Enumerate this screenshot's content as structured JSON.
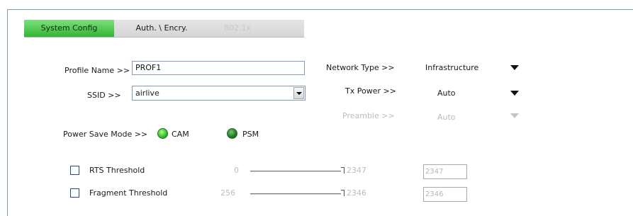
{
  "tabs": {
    "system_config": "System Config",
    "auth_encry": "Auth. \\ Encry.",
    "dot1x": "802.1x"
  },
  "profile": {
    "label": "Profile Name >>",
    "value": "PROF1"
  },
  "ssid": {
    "label": "SSID >>",
    "value": "airlive"
  },
  "network_type": {
    "label": "Network Type >>",
    "value": "Infrastructure"
  },
  "tx_power": {
    "label": "Tx Power >>",
    "value": "Auto"
  },
  "preamble": {
    "label": "Preamble >>",
    "value": "Auto"
  },
  "power_save": {
    "label": "Power Save Mode >>",
    "cam_label": "CAM",
    "psm_label": "PSM",
    "selected": "CAM"
  },
  "rts": {
    "label": "RTS Threshold",
    "min": "0",
    "max": "2347",
    "value": "2347",
    "checked": false
  },
  "fragment": {
    "label": "Fragment Threshold",
    "min": "256",
    "max": "2346",
    "value": "2346",
    "checked": false
  },
  "colors": {
    "accent_tab": "#34b434",
    "border": "#7f9db9",
    "disabled_text": "#bcbcbc"
  },
  "icons": [
    "dropdown-arrow-icon",
    "radio-icon",
    "checkbox-icon"
  ]
}
